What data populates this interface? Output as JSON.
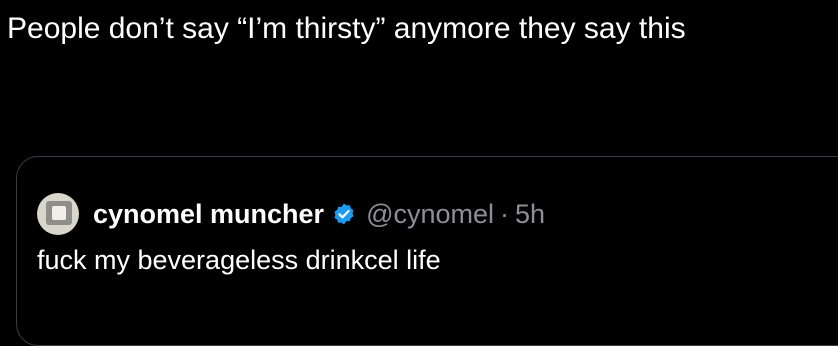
{
  "tweet": {
    "text": "People don’t say “I’m thirsty” anymore they say this"
  },
  "quoted_tweet": {
    "display_name": "cynomel muncher",
    "handle": "@cynomel",
    "separator": "·",
    "time": "5h",
    "text": "fuck my beverageless drinkcel life",
    "verified_icon": "verified-badge-icon",
    "avatar_icon": "avatar-icon"
  },
  "colors": {
    "background": "#000000",
    "text": "#ffffff",
    "secondary_text": "#8b9096",
    "verified": "#1d9bf0",
    "card_border": "#3a3d41"
  }
}
